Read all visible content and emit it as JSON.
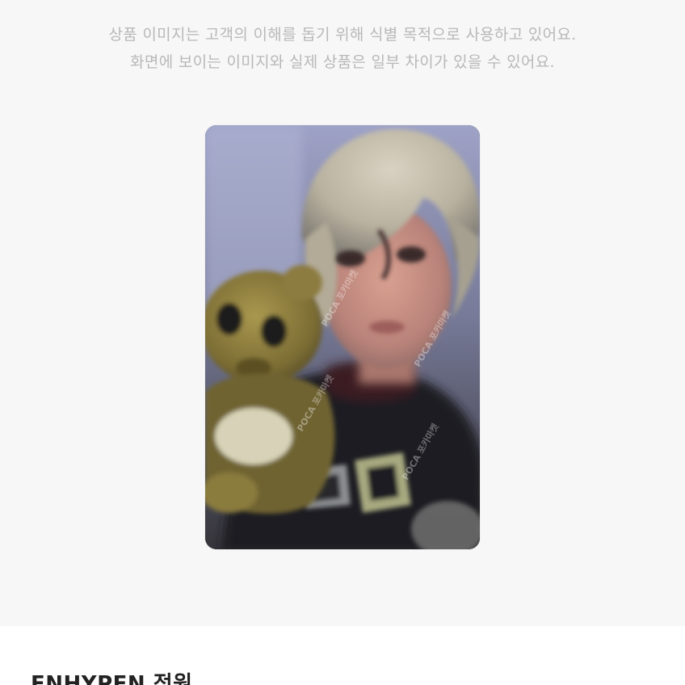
{
  "notice": {
    "line1": "상품 이미지는 고객의 이해를 돕기 위해 식별 목적으로 사용하고 있어요.",
    "line2": "화면에 보이는 이미지와 실제 상품은 일부 차이가 있을 수 있어요."
  },
  "product": {
    "title": "ENHYPEN 정원"
  },
  "photocard": {
    "watermark": "POCA 포카마켓"
  },
  "colors": {
    "panel_background": "#f7f7f7",
    "notice_text": "#b8b8b8",
    "title_text": "#222222"
  }
}
